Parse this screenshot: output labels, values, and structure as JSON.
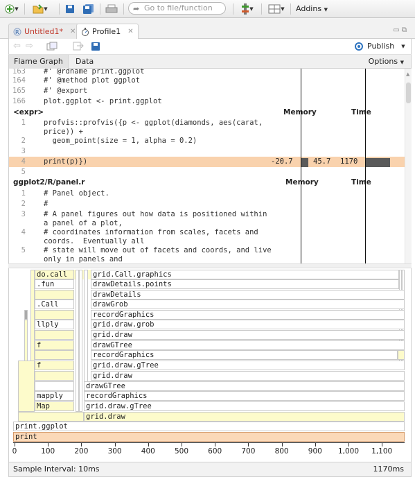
{
  "toolbar": {
    "goto_placeholder": "Go to file/function",
    "addins_label": "Addins"
  },
  "tabs": [
    {
      "label": "Untitled1*",
      "modified": true
    },
    {
      "label": "Profile1",
      "active": true
    }
  ],
  "doc_toolbar": {
    "publish_label": "Publish"
  },
  "subtabs": {
    "flame_graph": "Flame Graph",
    "data": "Data",
    "options": "Options"
  },
  "code": {
    "top_lines": [
      {
        "n": "163",
        "text": "#' @rdname print.ggplot"
      },
      {
        "n": "164",
        "text": "#' @method plot ggplot"
      },
      {
        "n": "165",
        "text": "#' @export"
      },
      {
        "n": "166",
        "text": "plot.ggplot <- print.ggplot"
      }
    ],
    "expr_header": {
      "file": "<expr>",
      "memory": "Memory",
      "time": "Time"
    },
    "expr_lines": [
      {
        "n": "1",
        "text": "profvis::profvis({p <- ggplot(diamonds, aes(carat,"
      },
      {
        "n": "",
        "text": "price)) +"
      },
      {
        "n": "2",
        "text": "  geom_point(size = 1, alpha = 0.2)"
      },
      {
        "n": "3",
        "text": ""
      },
      {
        "n": "4",
        "text": "print(p)})",
        "mem_neg": "-20.7",
        "mem_pos": "45.7",
        "time": "1170",
        "highlight": true
      },
      {
        "n": "5",
        "text": ""
      }
    ],
    "panel_header": {
      "file": "ggplot2/R/panel.r",
      "memory": "Memory",
      "time": "Time"
    },
    "panel_lines": [
      {
        "n": "1",
        "text": "# Panel object."
      },
      {
        "n": "2",
        "text": "#"
      },
      {
        "n": "3",
        "text": "# A panel figures out how data is positioned within"
      },
      {
        "n": "",
        "text": "a panel of a plot,"
      },
      {
        "n": "4",
        "text": "# coordinates information from scales, facets and"
      },
      {
        "n": "",
        "text": "coords.  Eventually all"
      },
      {
        "n": "5",
        "text": "# state will move out of facets and coords, and live"
      },
      {
        "n": "",
        "text": "only in panels and"
      }
    ]
  },
  "flame": {
    "labels": {
      "do_call": "do.call",
      "fun": ".fun",
      "call": ".Call",
      "llply": "llply",
      "f1": "f",
      "f2": "f",
      "mapply": "mapply",
      "map": "Map",
      "grid_call_graphics": "grid.Call.graphics",
      "draw_details_points": "drawDetails.points",
      "draw_details": "drawDetails",
      "draw_grob": "drawGrob",
      "record_graphics_1": "recordGraphics",
      "grid_draw_grob": "grid.draw.grob",
      "grid_draw_1": "grid.draw",
      "draw_gtree_1": "drawGTree",
      "record_graphics_2": "recordGraphics",
      "grid_draw_gtree_1": "grid.draw.gTree",
      "grid_draw_2": "grid.draw",
      "draw_gtree_2": "drawGTree",
      "record_graphics_3": "recordGraphics",
      "grid_draw_gtree_2": "grid.draw.gTree",
      "grid_draw_3": "grid.draw",
      "print_ggplot": "print.ggplot",
      "print": "print"
    },
    "axis_ticks": [
      "0",
      "100",
      "200",
      "300",
      "400",
      "500",
      "600",
      "700",
      "800",
      "900",
      "1,000",
      "1,100"
    ]
  },
  "status": {
    "sample_interval": "Sample Interval: 10ms",
    "total": "1170ms"
  },
  "colors": {
    "highlight": "#f9d2ad",
    "flame_yellow": "#fdfbcb",
    "flame_orange": "#fbd9b8",
    "publish_blue": "#2f74c0"
  }
}
